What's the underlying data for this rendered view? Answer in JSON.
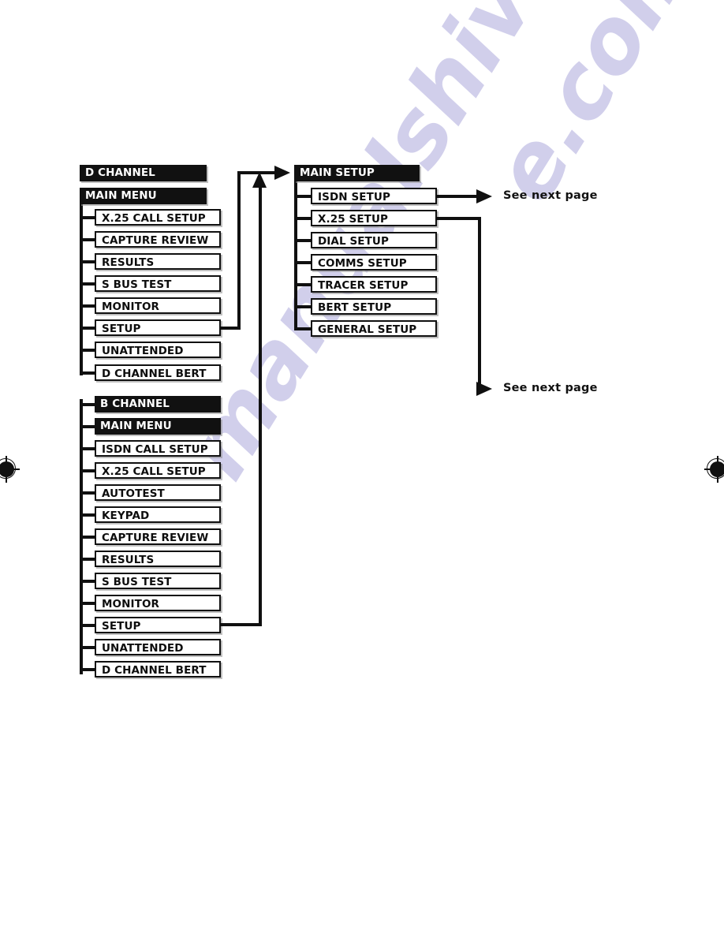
{
  "page": {
    "background_color": "#ffffff",
    "line_color": "#101010",
    "header_fill": "#111111",
    "header_text_color": "#ffffff",
    "box_text_color": "#0d0d0d",
    "watermark_color": "#c9c7e8",
    "watermark_text": "manualshive.com"
  },
  "d_channel_menu": {
    "headers": [
      {
        "label": "D CHANNEL"
      },
      {
        "label": "MAIN MENU"
      }
    ],
    "items": [
      {
        "label": "X.25 CALL SETUP"
      },
      {
        "label": "CAPTURE REVIEW"
      },
      {
        "label": "RESULTS"
      },
      {
        "label": "S BUS TEST"
      },
      {
        "label": "MONITOR"
      },
      {
        "label": "SETUP"
      },
      {
        "label": "UNATTENDED"
      },
      {
        "label": "D CHANNEL BERT"
      }
    ]
  },
  "b_channel_menu": {
    "headers": [
      {
        "label": "B CHANNEL"
      },
      {
        "label": "MAIN MENU"
      }
    ],
    "items": [
      {
        "label": "ISDN CALL SETUP"
      },
      {
        "label": "X.25 CALL SETUP"
      },
      {
        "label": "AUTOTEST"
      },
      {
        "label": "KEYPAD"
      },
      {
        "label": "CAPTURE REVIEW"
      },
      {
        "label": "RESULTS"
      },
      {
        "label": "S BUS TEST"
      },
      {
        "label": "MONITOR"
      },
      {
        "label": "SETUP"
      },
      {
        "label": "UNATTENDED"
      },
      {
        "label": "D CHANNEL BERT"
      }
    ]
  },
  "main_setup_menu": {
    "headers": [
      {
        "label": "MAIN SETUP"
      }
    ],
    "items": [
      {
        "label": "ISDN SETUP"
      },
      {
        "label": "X.25 SETUP"
      },
      {
        "label": "DIAL SETUP"
      },
      {
        "label": "COMMS SETUP"
      },
      {
        "label": "TRACER SETUP"
      },
      {
        "label": "BERT SETUP"
      },
      {
        "label": "GENERAL SETUP"
      }
    ]
  },
  "annotations": {
    "isdn_setup_note": "See next page",
    "x25_setup_note": "See next page"
  }
}
